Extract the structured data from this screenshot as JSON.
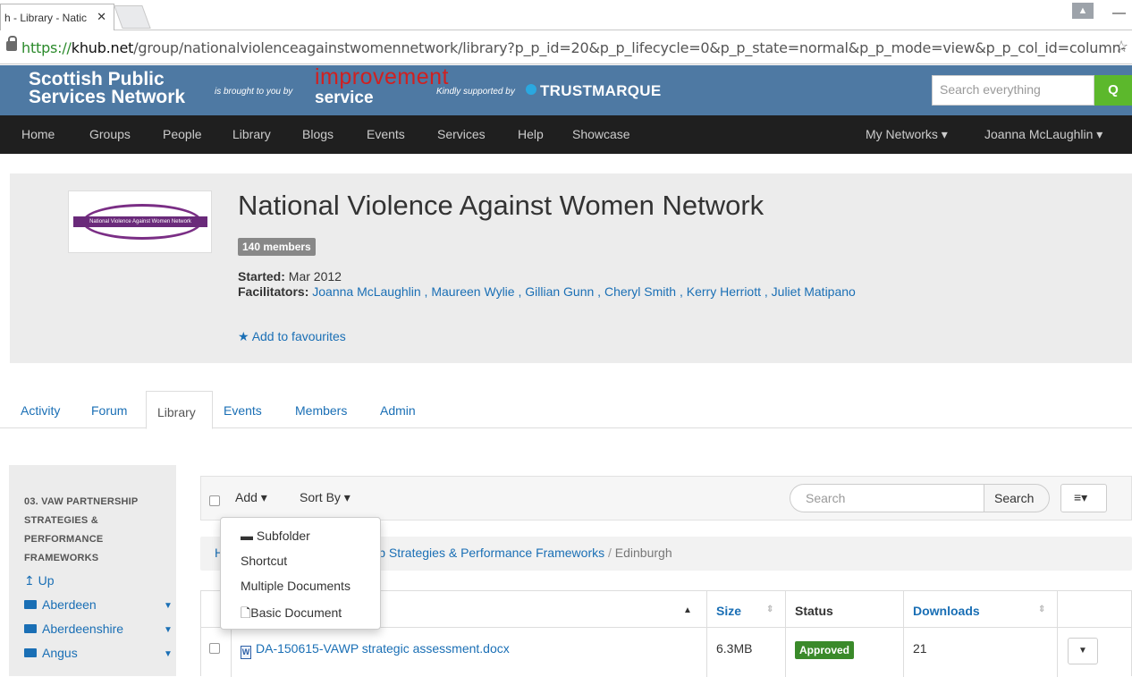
{
  "browser": {
    "tab_title": "h - Library - Natic",
    "tab_close": "✕",
    "url_scheme": "https://",
    "url_host": "khub.net",
    "url_path": "/group/nationalviolenceagainstwomennetwork/library?p_p_id=20&p_p_lifecycle=0&p_p_state=normal&p_p_mode=view&p_p_col_id=column-"
  },
  "site": {
    "title_line1": "Scottish Public",
    "title_line2": "Services Network",
    "brought": "is brought to you by",
    "improvement": "improvement",
    "service": "service",
    "kindly": "Kindly supported by",
    "sponsor": "TRUSTMARQUE",
    "search_placeholder": "Search everything",
    "search_icon_glyph": "Q"
  },
  "nav": {
    "items": [
      "Home",
      "Groups",
      "People",
      "Library",
      "Blogs",
      "Events",
      "Services",
      "Help",
      "Showcase"
    ],
    "my_networks": "My Networks ▾",
    "user": "Joanna McLaughlin ▾"
  },
  "group": {
    "logo_text": "National Violence Against Women Network",
    "title": "National Violence Against Women Network",
    "members": "140 members",
    "started_label": "Started:",
    "started_value": " Mar 2012",
    "facilitators_label": "Facilitators:",
    "facilitators": " Joanna McLaughlin , Maureen Wylie , Gillian Gunn , Cheryl Smith , Kerry Herriott , Juliet Matipano",
    "favourites": "Add to favourites"
  },
  "tabs": {
    "activity": "Activity",
    "forum": "Forum",
    "library": "Library",
    "events": "Events",
    "members": "Members",
    "admin": "Admin"
  },
  "sidebar": {
    "folder": "03. VAW PARTNERSHIP STRATEGIES & PERFORMANCE FRAMEWORKS",
    "up": "Up",
    "folders": [
      "Aberdeen",
      "Aberdeenshire",
      "Angus"
    ]
  },
  "toolbar": {
    "add": "Add ▾",
    "sort_by": "Sort By ▾",
    "search_placeholder": "Search",
    "search_button": "Search",
    "view_icon": "≡▾"
  },
  "add_menu": {
    "subfolder": "Subfolder",
    "shortcut": "Shortcut",
    "multiple": "Multiple Documents",
    "basic": "Basic Document"
  },
  "breadcrumb": {
    "first": "H",
    "middle": "ip Strategies & Performance Frameworks",
    "sep": " / ",
    "current": "Edinburgh"
  },
  "table": {
    "headers": {
      "size": "Size",
      "status": "Status",
      "downloads": "Downloads"
    },
    "rows": [
      {
        "name": "DA-150615-VAWP strategic assessment.docx",
        "size": "6.3MB",
        "status": "Approved",
        "downloads": "21"
      }
    ]
  },
  "colors": {
    "header_bg": "#4e79a3",
    "nav_bg": "#1f1f1f",
    "link": "#1a6fb5",
    "approved": "#3a8a2a",
    "search_green": "#5cb82c"
  }
}
